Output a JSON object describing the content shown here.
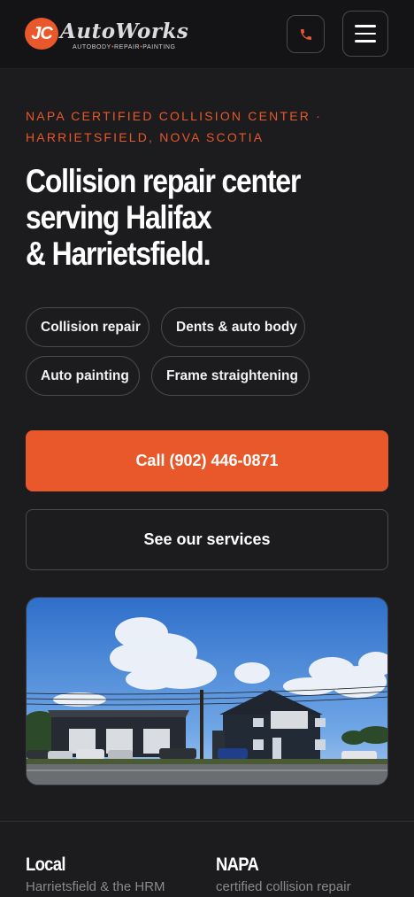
{
  "header": {
    "logo_badge": "JC",
    "logo_word": "AutoWorks",
    "logo_tagline": [
      "AUTOBODY",
      "REPAIR",
      "PAINTING"
    ]
  },
  "hero": {
    "eyebrow_line1": "NAPA CERTIFIED COLLISION CENTER ·",
    "eyebrow_line2": "HARRIETSFIELD, NOVA SCOTIA",
    "headline_line1": "Collision repair center",
    "headline_line2": "serving Halifax",
    "headline_line3": "& Harrietsfield.",
    "chips": [
      "Collision repair",
      "Dents & auto body",
      "Auto painting",
      "Frame straightening"
    ],
    "cta_call": "Call (902) 446-0871",
    "cta_services": "See our services"
  },
  "stats": [
    {
      "title": "Local",
      "subtitle": "Harrietsfield & the HRM"
    },
    {
      "title": "NAPA",
      "subtitle": "certified collision repair"
    }
  ],
  "colors": {
    "background": "#1c1c1e",
    "header": "#141416",
    "accent": "#e8582a",
    "border": "#4a4a4e",
    "muted_text": "#8a8a8e"
  },
  "icons": {
    "phone": "phone-icon",
    "menu": "hamburger-menu-icon"
  }
}
